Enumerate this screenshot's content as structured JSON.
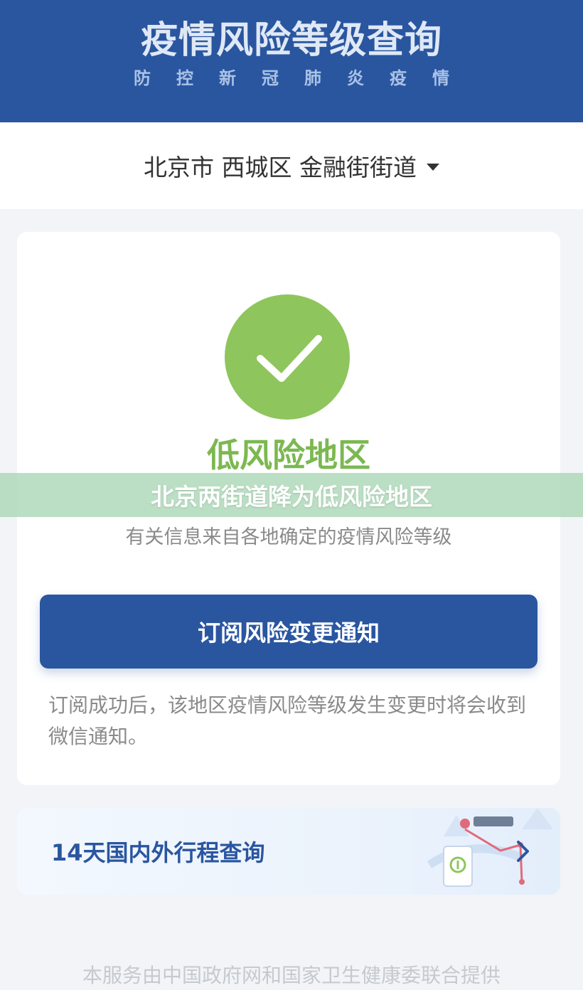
{
  "header": {
    "title": "疫情风险等级查询",
    "subtitle": "防控新冠肺炎疫情"
  },
  "region": {
    "label": "北京市 西城区 金融街街道",
    "dropdown_icon": "caret-down-icon"
  },
  "status": {
    "icon": "check-icon",
    "level": "低风险地区",
    "info": "有关信息来自各地确定的疫情风险等级",
    "color": "#8ec55c"
  },
  "overlay": {
    "headline": "北京两街道降为低风险地区"
  },
  "subscribe": {
    "button_label": "订阅风险变更通知",
    "note": "订阅成功后，该地区疫情风险等级发生变更时将会收到微信通知。"
  },
  "trip": {
    "label": "14天国内外行程查询",
    "icon": "chevron-right-icon"
  },
  "footer": {
    "text": "本服务由中国政府网和国家卫生健康委联合提供"
  },
  "colors": {
    "brand_blue": "#2a56a0",
    "low_risk_green": "#7cb850"
  }
}
